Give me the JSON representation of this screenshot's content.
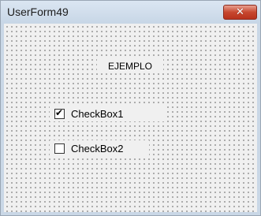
{
  "window": {
    "title": "UserForm49",
    "close_glyph": "✕"
  },
  "form": {
    "label_text": "EJEMPLO",
    "checkboxes": [
      {
        "label": "CheckBox1",
        "checked": true
      },
      {
        "label": "CheckBox2",
        "checked": false
      }
    ]
  },
  "colors": {
    "form_background": "#f0f0f0",
    "close_button": "#c7472f",
    "grid_dots": "#6e6e6e"
  }
}
